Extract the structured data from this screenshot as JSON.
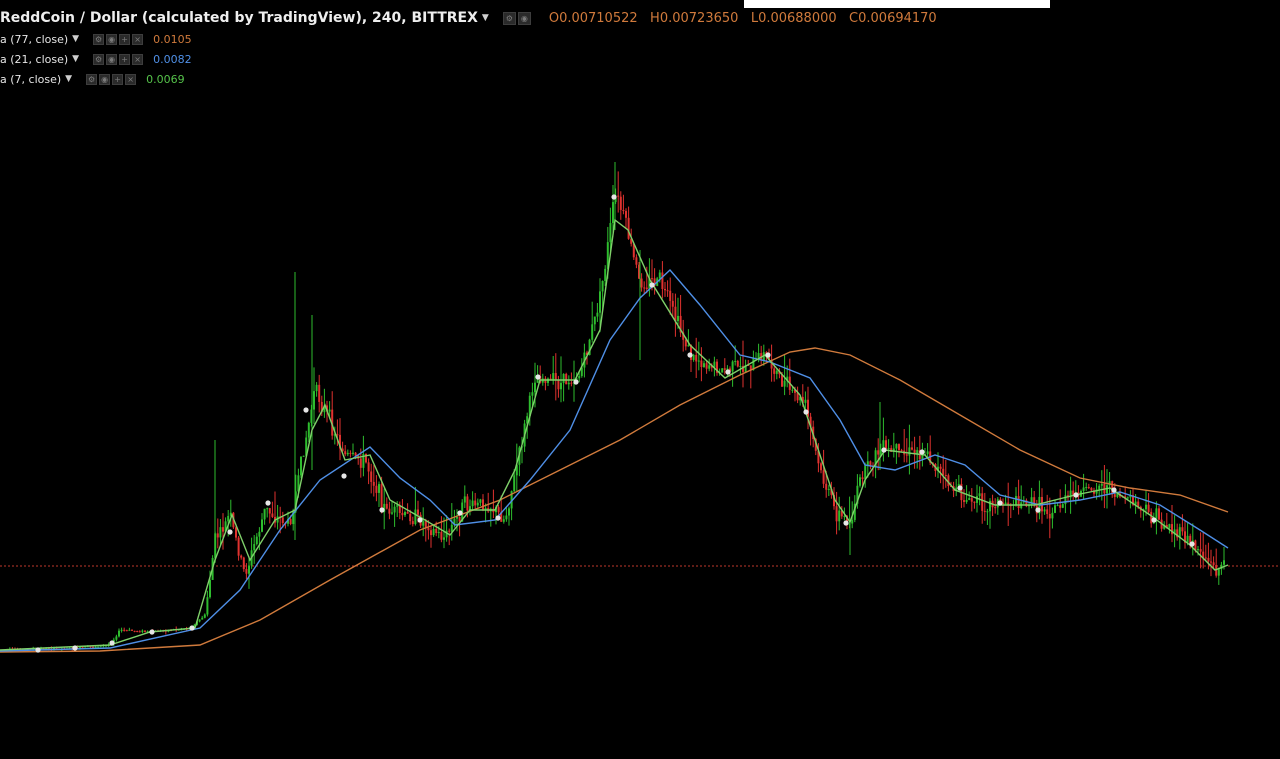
{
  "header": {
    "title": "ReddCoin / Dollar (calculated by TradingView), 240, BITTREX",
    "ohlc": {
      "open_label": "O",
      "open": "0.00710522",
      "high_label": "H",
      "high": "0.00723650",
      "low_label": "L",
      "low": "0.00688000",
      "close_label": "C",
      "close": "0.00694170"
    }
  },
  "indicators": [
    {
      "label": "a (77, close)",
      "value": "0.0105",
      "color": "#d07a3c"
    },
    {
      "label": "a (21, close)",
      "value": "0.0082",
      "color": "#4f8fe6"
    },
    {
      "label": "a (7, close)",
      "value": "0.0069",
      "color": "#55c24a"
    }
  ],
  "icons": [
    "gear-icon",
    "eye-icon",
    "plus-icon",
    "close-icon"
  ],
  "colors": {
    "background": "#000000",
    "up_candle": "#2ebd2e",
    "down_candle": "#e0322f",
    "price_line": "#c0392b",
    "ma77": "#d07a3c",
    "ma21": "#4f8fe6",
    "ma7": "#7fd06a"
  }
}
